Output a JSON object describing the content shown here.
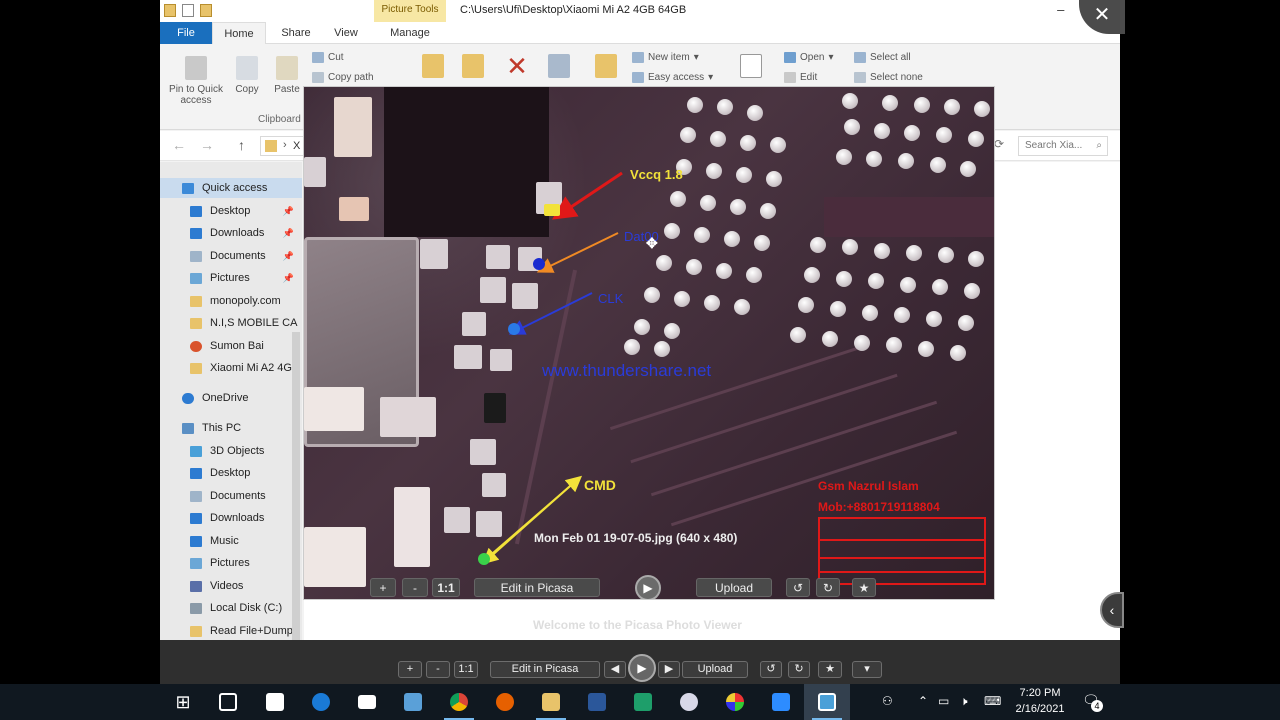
{
  "explorer": {
    "context_tab": "Picture Tools",
    "title_path": "C:\\Users\\Ufi\\Desktop\\Xiaomi Mi A2 4GB 64GB",
    "tabs": [
      "File",
      "Home",
      "Share",
      "View",
      "Manage"
    ],
    "ribbon": {
      "pin": "Pin to Quick access",
      "copy": "Copy",
      "paste": "Paste",
      "cut": "Cut",
      "copy_path": "Copy path",
      "clipboard_group": "Clipboard",
      "new_item": "New item",
      "easy_access": "Easy access",
      "open": "Open",
      "edit": "Edit",
      "select_all": "Select all",
      "select_none": "Select none"
    },
    "address_fragment": "X",
    "search_placeholder": "Search Xia...",
    "nav": {
      "quick_access": "Quick access",
      "qa_items": [
        "Desktop",
        "Downloads",
        "Documents",
        "Pictures",
        "monopoly.com",
        "N.I,S MOBILE CA",
        "Sumon Bai",
        "Xiaomi Mi A2 4G"
      ],
      "onedrive": "OneDrive",
      "this_pc": "This PC",
      "pc_items": [
        "3D Objects",
        "Desktop",
        "Documents",
        "Downloads",
        "Music",
        "Pictures",
        "Videos",
        "Local Disk (C:)",
        "Read File+Dump"
      ]
    }
  },
  "photo": {
    "labels": {
      "vccq": "Vccq 1.8",
      "dat0": "Dat00",
      "clk": "CLK",
      "cmd": "CMD"
    },
    "watermark": "www.thundershare.net",
    "credit_name": "Gsm Nazrul Islam",
    "credit_phone": "Mob:+8801719118804",
    "caption": "Mon Feb 01 19-07-05.jpg (640 x 480)",
    "toolbar": {
      "zoom_in": "+",
      "zoom_out": "-",
      "actual": "1:1",
      "edit": "Edit in Picasa",
      "upload": "Upload"
    }
  },
  "viewer": {
    "welcome": "Welcome to the Picasa Photo Viewer",
    "zoom_in": "+",
    "zoom_out": "-",
    "actual": "1:1",
    "edit": "Edit in Picasa",
    "upload": "Upload"
  },
  "taskbar": {
    "time": "7:20 PM",
    "date": "2/16/2021",
    "notifications": "4"
  },
  "colors": {
    "vccq": "#f2e23a",
    "dat0": "#2a3bd8",
    "clk": "#2a3bd8",
    "cmd": "#f2e23a",
    "accent_red": "#e01818",
    "file_tab": "#1a6fbe"
  }
}
